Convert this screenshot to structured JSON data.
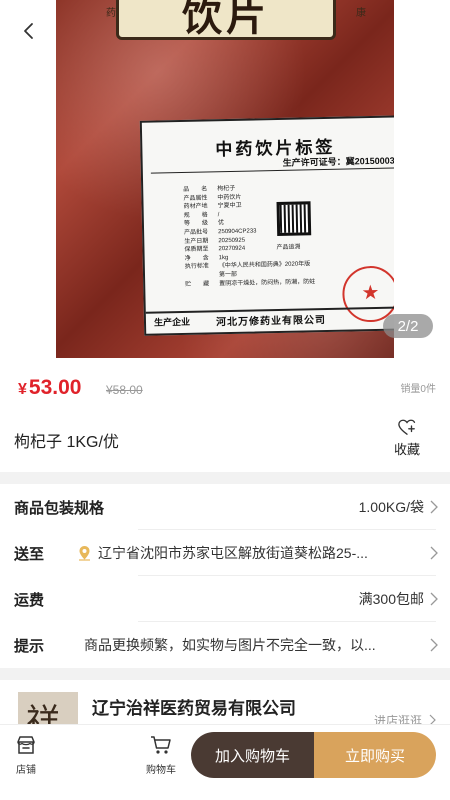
{
  "product_image": {
    "counter": "2/2",
    "bag_top_text": "饮片",
    "bag_top_left": "药",
    "bag_top_right": "康",
    "label_title": "中药饮片标签",
    "license": "生产许可证号：冀20150003",
    "label_rows": [
      {
        "k": "品　　名",
        "v": "枸杞子"
      },
      {
        "k": "产品属性",
        "v": "中药饮片"
      },
      {
        "k": "药材产地",
        "v": "宁夏中卫"
      },
      {
        "k": "规　　格",
        "v": "/"
      },
      {
        "k": "等　　级",
        "v": "优"
      },
      {
        "k": "产品批号",
        "v": "250904CP233"
      },
      {
        "k": "生产日期",
        "v": "20250925"
      },
      {
        "k": "保质期至",
        "v": "20270924"
      },
      {
        "k": "净　　含",
        "v": "1kg"
      },
      {
        "k": "执行标准",
        "v": "《中华人民共和国药典》2020年版第一部"
      },
      {
        "k": "贮　　藏",
        "v": "置阴凉干燥处，防闷热，防潮，防蛀"
      }
    ],
    "qr_caption": "产品追溯",
    "company_key": "生产企业",
    "company_value": "河北万修药业有限公司"
  },
  "price": {
    "symbol": "¥",
    "current": "53.00",
    "original": "¥58.00",
    "sales": "销量0件"
  },
  "product_title": "枸杞子 1KG/优",
  "favorite_label": "收藏",
  "specs": [
    {
      "key": "商品包装规格",
      "value": "1.00KG/袋"
    },
    {
      "key": "送至",
      "value": "辽宁省沈阳市苏家屯区解放街道葵松路25-..."
    },
    {
      "key": "运费",
      "value": "满300包邮"
    },
    {
      "key": "提示",
      "value": "商品更换频繁，如实物与图片不完全一致，以..."
    }
  ],
  "shop": {
    "logo_char": "祥",
    "name": "辽宁治祥医药贸易有限公司",
    "visit_label": "进店逛逛"
  },
  "bottom_bar": {
    "store_label": "店铺",
    "cart_label": "购物车",
    "add_to_cart": "加入购物车",
    "buy_now": "立即购买"
  },
  "colors": {
    "price_red": "#e0222a",
    "cart_button": "#4a3a33",
    "buy_button": "#d9a35c"
  }
}
